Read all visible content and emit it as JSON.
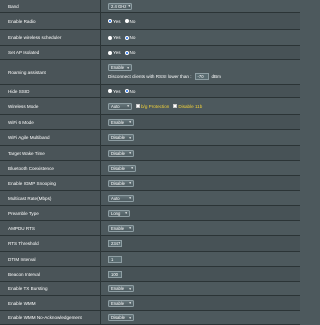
{
  "rows": {
    "band": {
      "label": "Band",
      "value": "2.4 GHz"
    },
    "enable_radio": {
      "label": "Enable Radio",
      "yes": "Yes",
      "no": "No",
      "selected": "Yes"
    },
    "wireless_scheduler": {
      "label": "Enable wireless scheduler",
      "yes": "Yes",
      "no": "No",
      "selected": "No"
    },
    "ap_isolated": {
      "label": "Set AP Isolated",
      "yes": "Yes",
      "no": "No",
      "selected": "No"
    },
    "roaming_assistant": {
      "label": "Roaming assistant",
      "value": "Enable",
      "note": "Disconnect clients with RSSI lower than :",
      "rssi": "-70",
      "unit": "dBm"
    },
    "hide_ssid": {
      "label": "Hide SSID",
      "yes": "Yes",
      "no": "No",
      "selected": "No"
    },
    "wireless_mode": {
      "label": "Wireless Mode",
      "value": "Auto",
      "opt1": "b/g Protection",
      "opt2": "Disable 11b"
    },
    "wifi6_mode": {
      "label": "WiFi 6 Mode",
      "value": "Enable"
    },
    "wifi_agile": {
      "label": "WiFi Agile Multiband",
      "value": "Disable"
    },
    "target_wake": {
      "label": "Target Wake Time",
      "value": "Disable"
    },
    "bluetooth": {
      "label": "Bluetooth Coexistence",
      "value": "Disable"
    },
    "igmp": {
      "label": "Enable IGMP Snooping",
      "value": "Disable"
    },
    "multicast": {
      "label": "Multicast Rate(Mbps)",
      "value": "Auto"
    },
    "preamble": {
      "label": "Preamble Type",
      "value": "Long"
    },
    "ampdu_rts": {
      "label": "AMPDU RTS",
      "value": "Enable"
    },
    "rts_threshold": {
      "label": "RTS Threshold",
      "value": "2347"
    },
    "dtim": {
      "label": "DTIM Interval",
      "value": "1"
    },
    "beacon": {
      "label": "Beacon Interval",
      "value": "100"
    },
    "tx_bursting": {
      "label": "Enable TX Bursting",
      "value": "Enable"
    },
    "wmm": {
      "label": "Enable WMM",
      "value": "Enable"
    },
    "wmm_noack": {
      "label": "Enable WMM No-Acknowledgement",
      "value": "Disable"
    }
  }
}
